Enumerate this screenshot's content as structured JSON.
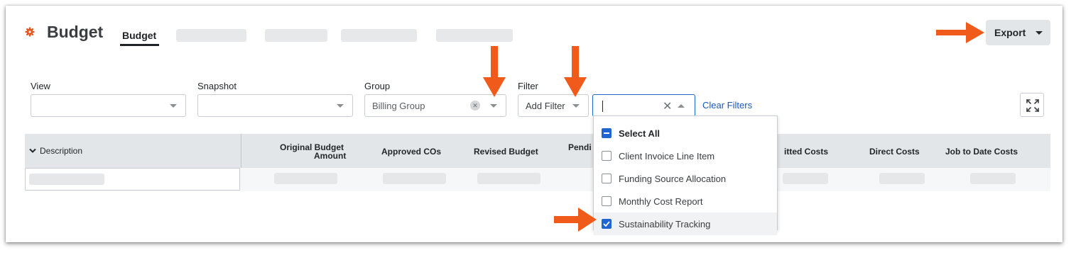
{
  "header": {
    "app_icon": "gear-icon",
    "title": "Budget",
    "active_tab": "Budget",
    "export_label": "Export"
  },
  "filters": {
    "view": {
      "label": "View",
      "value": ""
    },
    "snapshot": {
      "label": "Snapshot",
      "value": ""
    },
    "group": {
      "label": "Group",
      "value": "Billing Group"
    },
    "filter": {
      "label": "Filter",
      "add_filter": "Add Filter",
      "search_value": "",
      "clear_filters": "Clear Filters"
    }
  },
  "table": {
    "columns": [
      "Description",
      "Original Budget",
      "Amount",
      "Approved COs",
      "Revised Budget",
      "Pendi",
      "itted Costs",
      "Direct Costs",
      "Job to Date Costs"
    ]
  },
  "menu": {
    "select_all": "Select All",
    "items": [
      {
        "label": "Client Invoice Line Item",
        "checked": false
      },
      {
        "label": "Funding Source Allocation",
        "checked": false
      },
      {
        "label": "Monthly Cost Report",
        "checked": false
      },
      {
        "label": "Sustainability Tracking",
        "checked": true
      }
    ]
  },
  "colors": {
    "accent": "#2066d1",
    "annotation_arrow": "#f05a1a",
    "brand_icon": "#e8541e"
  }
}
